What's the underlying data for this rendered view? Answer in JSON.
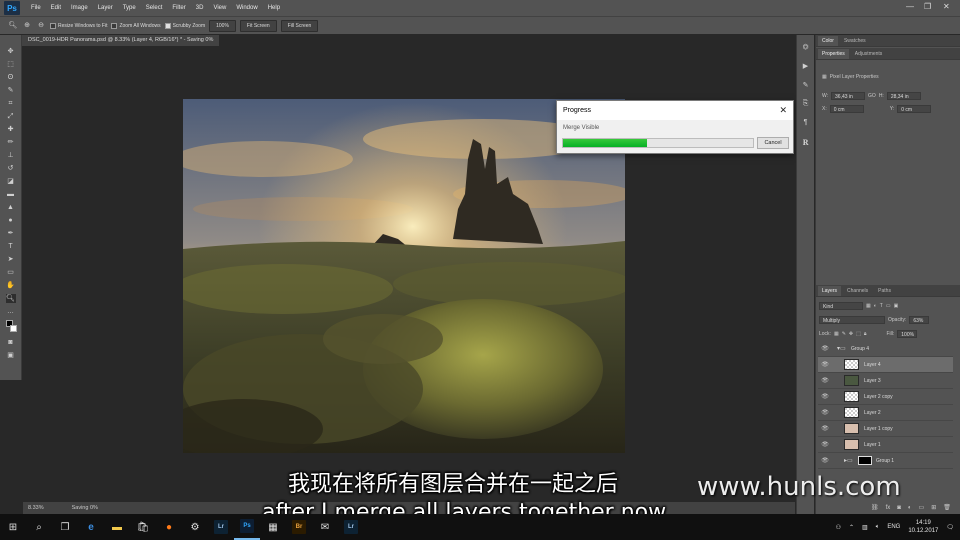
{
  "app": {
    "logo": "Ps"
  },
  "menu": [
    "File",
    "Edit",
    "Image",
    "Layer",
    "Type",
    "Select",
    "Filter",
    "3D",
    "View",
    "Window",
    "Help"
  ],
  "options_bar": {
    "resize_windows": "Resize Windows to Fit",
    "zoom_all_windows": "Zoom All Windows",
    "scrubby_zoom": "Scrubby Zoom",
    "zoom_100": "100%",
    "fit_screen": "Fit Screen",
    "fill_screen": "Fill Screen"
  },
  "document": {
    "tab_title": "DSC_0019-HDR Panorama.psd @ 8.33% (Layer 4, RGB/16*) * - Saving 0%"
  },
  "dialog": {
    "title": "Progress",
    "task": "Merge Visible",
    "progress": 0.44,
    "cancel": "Cancel"
  },
  "status_bar": {
    "zoom": "8.33%",
    "status": "Saving 0%"
  },
  "panels": {
    "color_tabs": [
      "Color",
      "Swatches"
    ],
    "properties_tabs": [
      "Properties",
      "Adjustments"
    ],
    "properties_title": "Pixel Layer Properties",
    "w_label": "W:",
    "w_value": "36,43 in",
    "h_label": "H:",
    "h_value": "28,34 in",
    "link": "GO",
    "x_label": "X:",
    "x_value": "0 cm",
    "y_label": "Y:",
    "y_value": "0 cm",
    "layers_tabs": [
      "Layers",
      "Channels",
      "Paths"
    ],
    "kind": "Kind",
    "blend_mode": "Multiply",
    "opacity_label": "Opacity:",
    "opacity_value": "63%",
    "lock_label": "Lock:",
    "fill_label": "Fill:",
    "fill_value": "100%",
    "layers": [
      {
        "name": "Group 4",
        "type": "group"
      },
      {
        "name": "Layer 4",
        "type": "layer"
      },
      {
        "name": "Layer 3",
        "type": "layer"
      },
      {
        "name": "Layer 2 copy",
        "type": "layer"
      },
      {
        "name": "Layer 2",
        "type": "layer"
      },
      {
        "name": "Layer 1 copy",
        "type": "layer"
      },
      {
        "name": "Layer 1",
        "type": "layer"
      },
      {
        "name": "Group 1",
        "type": "group"
      }
    ]
  },
  "subtitles": {
    "chinese": "我现在将所有图层合并在一起之后",
    "english": "after I merge all layers together now"
  },
  "watermark": "www.hunls.com",
  "taskbar": {
    "apps": [
      "Lr",
      "Ps",
      "Br",
      "Lr"
    ],
    "lang": "ENG",
    "time": "14:19",
    "date": "10.12.2017"
  },
  "icons": {
    "window_controls": [
      "minimize-icon",
      "restore-icon",
      "close-icon"
    ],
    "colors": {
      "accent": "#31a8ff",
      "progress": "#06b025",
      "panel": "#535353",
      "canvas": "#282828"
    }
  }
}
